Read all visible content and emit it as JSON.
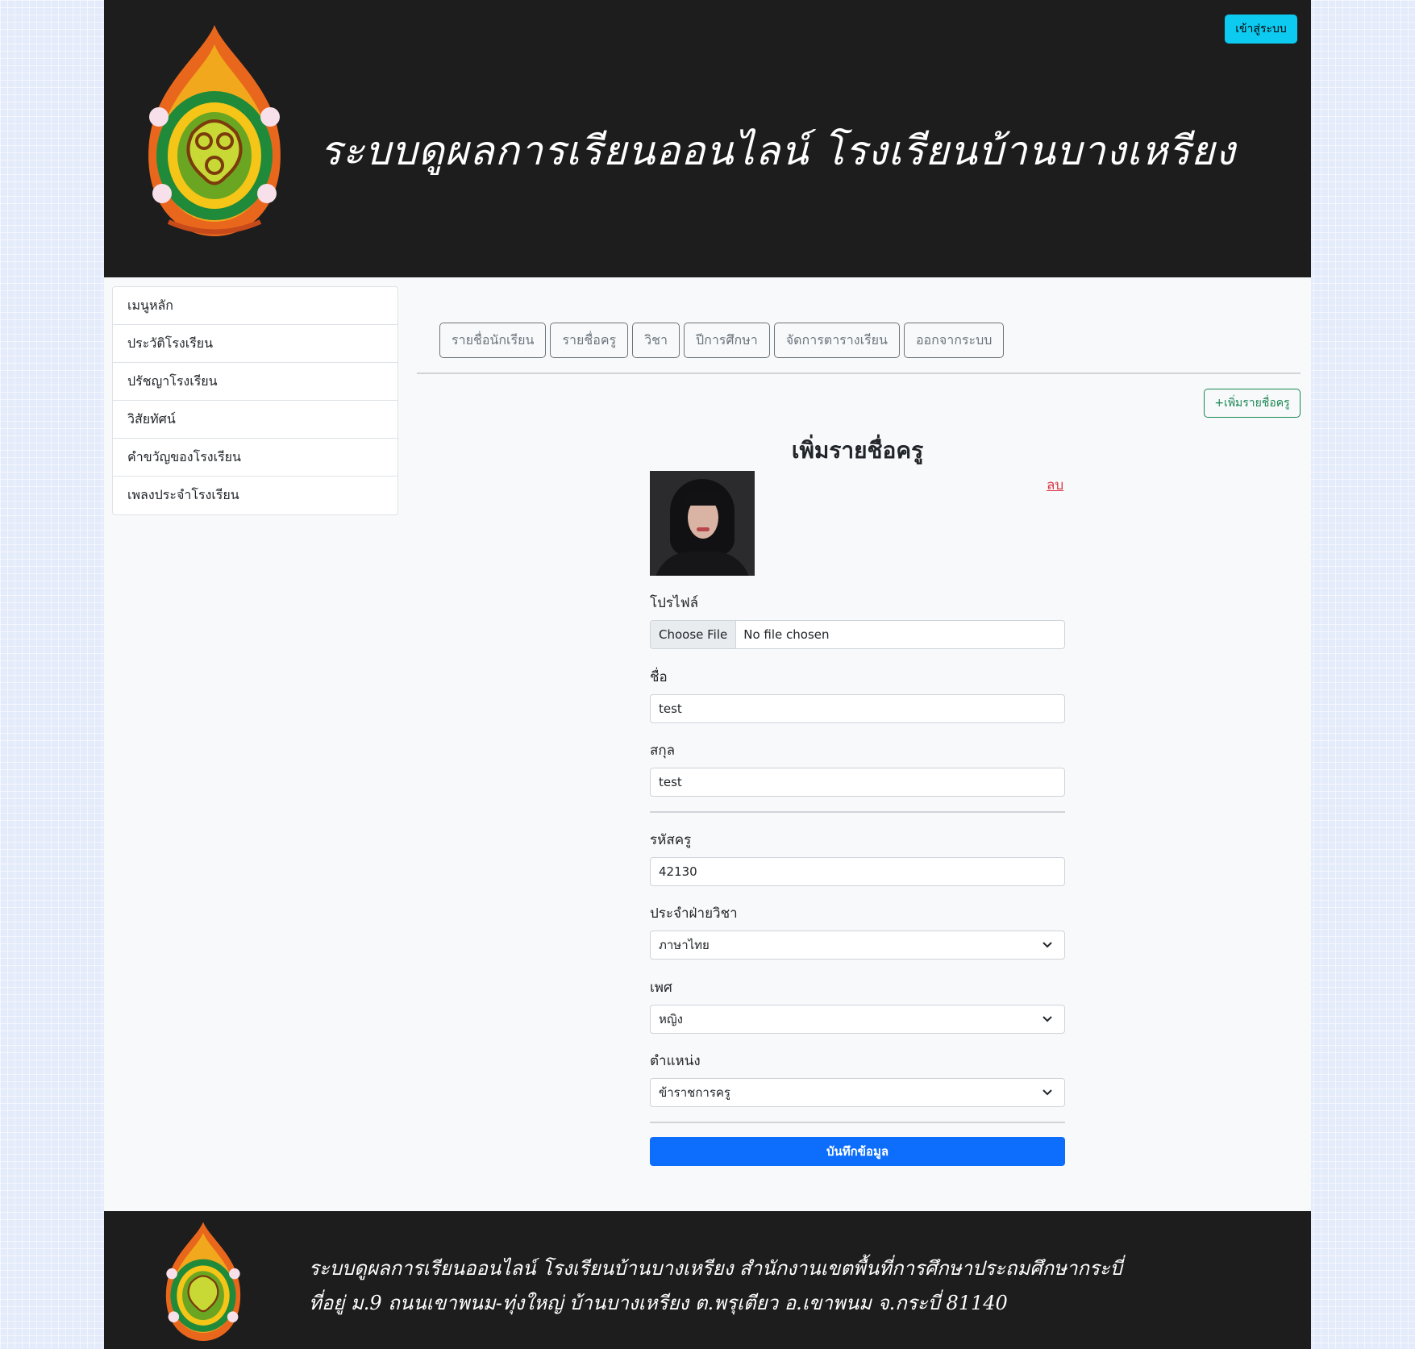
{
  "header": {
    "title": "ระบบดูผลการเรียนออนไลน์ โรงเรียนบ้านบางเหรียง",
    "login_button": "เข้าสู่ระบบ"
  },
  "sidebar": {
    "items": [
      {
        "label": "เมนูหลัก"
      },
      {
        "label": "ประวัติโรงเรียน"
      },
      {
        "label": "ปรัชญาโรงเรียน"
      },
      {
        "label": "วิสัยทัศน์"
      },
      {
        "label": "คำขวัญของโรงเรียน"
      },
      {
        "label": "เพลงประจำโรงเรียน"
      }
    ]
  },
  "nav": {
    "tabs": [
      {
        "label": "รายชื่อนักเรียน"
      },
      {
        "label": "รายชื่อครู"
      },
      {
        "label": "วิชา"
      },
      {
        "label": "ปีการศึกษา"
      },
      {
        "label": "จัดการตารางเรียน"
      },
      {
        "label": "ออกจากระบบ"
      }
    ],
    "add_button": "+เพิ่มรายชื่อครู"
  },
  "form": {
    "title": "เพิ่มรายชื่อครู",
    "delete_link": "ลบ",
    "profile_label": "โปรไฟล์",
    "file_button": "Choose File",
    "file_status": "No file chosen",
    "first_name_label": "ชื่อ",
    "first_name_value": "test",
    "last_name_label": "สกุล",
    "last_name_value": "test",
    "teacher_id_label": "รหัสครู",
    "teacher_id_value": "42130",
    "department_label": "ประจำฝ่ายวิชา",
    "department_value": "ภาษาไทย",
    "gender_label": "เพศ",
    "gender_value": "หญิง",
    "position_label": "ตำแหน่ง",
    "position_value": "ข้าราชการครู",
    "save_button": "บันทึกข้อมูล"
  },
  "footer": {
    "line1": "ระบบดูผลการเรียนออนไลน์ โรงเรียนบ้านบางเหรียง  สำนักงานเขตพื้นที่การศึกษาประถมศึกษากระบี่",
    "line2": "ที่อยู่ ม.9 ถนนเขาพนม-ทุ่งใหญ่  บ้านบางเหรียง  ต.พรุเตียว  อ.เขาพนม จ.กระบี่  81140"
  },
  "colors": {
    "header_bg": "#1d1d1d",
    "login_button": "#0dcaf0",
    "add_button": "#198754",
    "save_button": "#0d6efd",
    "delete_link": "#dc3545"
  },
  "icons": {
    "logo": "school-emblem-icon",
    "select_arrow": "chevron-down-icon"
  }
}
